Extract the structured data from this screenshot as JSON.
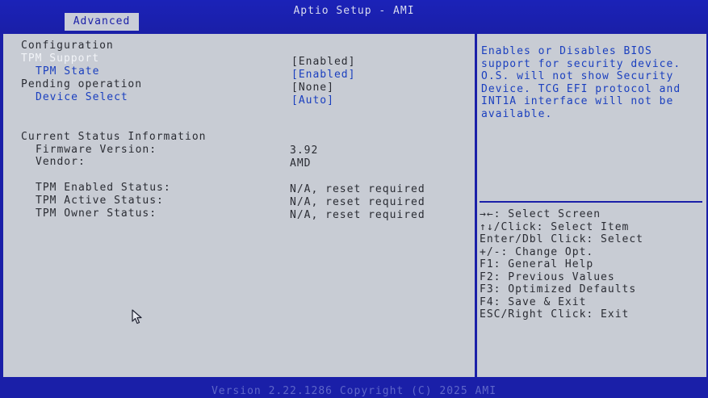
{
  "header": {
    "title": "Aptio Setup - AMI",
    "active_tab": "Advanced"
  },
  "settings": {
    "section_title": "Configuration",
    "items": [
      {
        "label": "TPM Support",
        "value": "[Enabled]"
      },
      {
        "label": "TPM State",
        "value": "[Enabled]"
      },
      {
        "label": "Pending operation",
        "value": "[None]"
      },
      {
        "label": "Device Select",
        "value": "[Auto]"
      }
    ]
  },
  "status": {
    "section_title": "Current Status Information",
    "firmware_label": "Firmware Version:",
    "firmware_value": "3.92",
    "vendor_label": "Vendor:",
    "vendor_value": "AMD",
    "enabled_label": "TPM Enabled Status:",
    "enabled_value": "N/A, reset required",
    "active_label": "TPM Active Status:",
    "active_value": "N/A, reset required",
    "owner_label": "TPM Owner Status:",
    "owner_value": "N/A, reset required"
  },
  "help": {
    "lines": [
      "Enables or Disables BIOS",
      "support for security device.",
      "O.S. will not show Security",
      "Device. TCG EFI protocol and",
      "INT1A interface will not be",
      "available."
    ]
  },
  "keys": [
    "→←: Select Screen",
    "↑↓/Click: Select Item",
    "Enter/Dbl Click: Select",
    "+/-: Change Opt.",
    "F1: General Help",
    "F2: Previous Values",
    "F3: Optimized Defaults",
    "F4: Save & Exit",
    "ESC/Right Click: Exit"
  ],
  "footer": {
    "text": "Version 2.22.1286 Copyright (C) 2025 AMI"
  },
  "colors": {
    "frame_blue": "#1a1fa8",
    "panel_gray": "#c8ccd4",
    "selectable_blue": "#1a3fbf",
    "highlight_white": "#f2f4f8"
  }
}
